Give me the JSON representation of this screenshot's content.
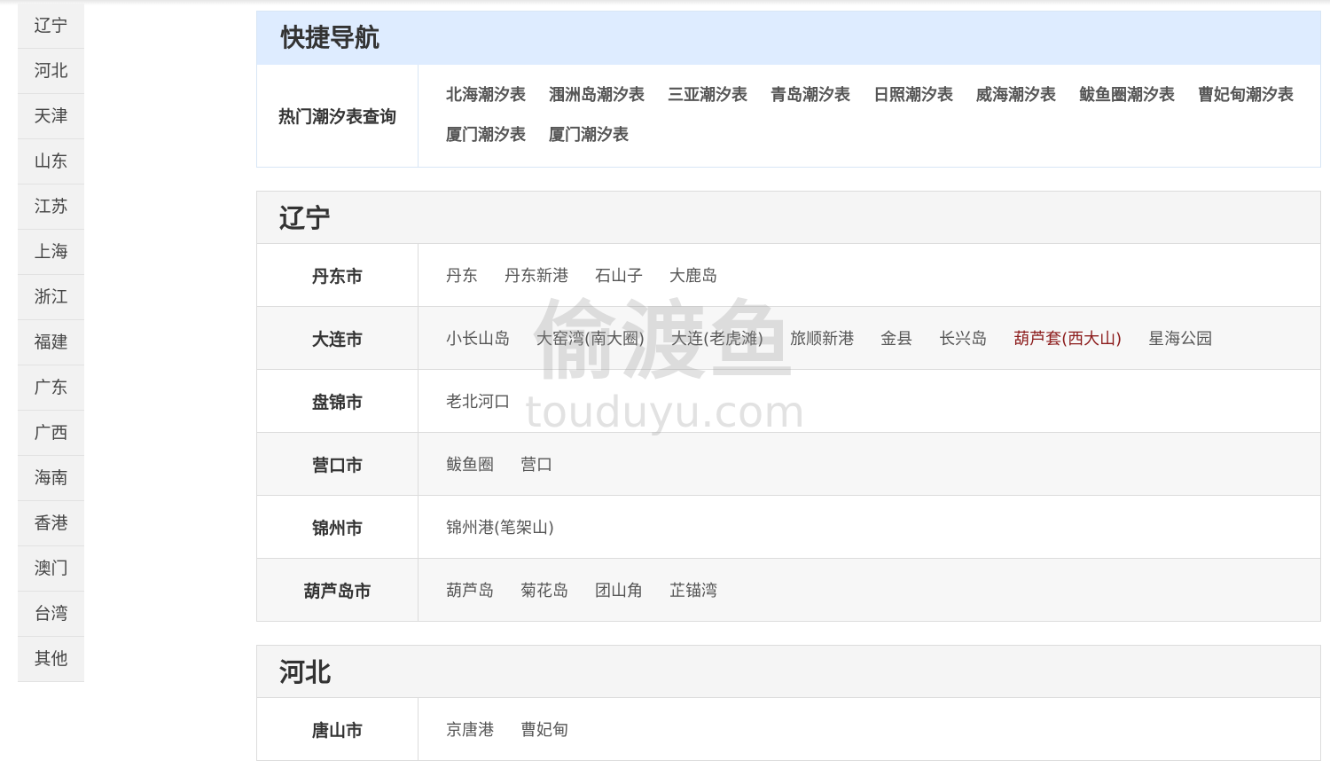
{
  "sidebar": {
    "items": [
      "辽宁",
      "河北",
      "天津",
      "山东",
      "江苏",
      "上海",
      "浙江",
      "福建",
      "广东",
      "广西",
      "海南",
      "香港",
      "澳门",
      "台湾",
      "其他"
    ]
  },
  "quicknav": {
    "title": "快捷导航",
    "label": "热门潮汐表查询",
    "links": [
      "北海潮汐表",
      "涠洲岛潮汐表",
      "三亚潮汐表",
      "青岛潮汐表",
      "日照潮汐表",
      "威海潮汐表",
      "鲅鱼圈潮汐表",
      "曹妃甸潮汐表",
      "厦门潮汐表",
      "厦门潮汐表"
    ]
  },
  "provinces": [
    {
      "name": "辽宁",
      "cities": [
        {
          "name": "丹东市",
          "ports": [
            "丹东",
            "丹东新港",
            "石山子",
            "大鹿岛"
          ]
        },
        {
          "name": "大连市",
          "ports": [
            "小长山岛",
            "大窑湾(南大圈)",
            "大连(老虎滩)",
            "旅顺新港",
            "金县",
            "长兴岛",
            "葫芦套(西大山)",
            "星海公园"
          ]
        },
        {
          "name": "盘锦市",
          "ports": [
            "老北河口"
          ]
        },
        {
          "name": "营口市",
          "ports": [
            "鲅鱼圈",
            "营口"
          ]
        },
        {
          "name": "锦州市",
          "ports": [
            "锦州港(笔架山)"
          ]
        },
        {
          "name": "葫芦岛市",
          "ports": [
            "葫芦岛",
            "菊花岛",
            "团山角",
            "芷锚湾"
          ]
        }
      ]
    },
    {
      "name": "河北",
      "cities": [
        {
          "name": "唐山市",
          "ports": [
            "京唐港",
            "曹妃甸"
          ]
        }
      ]
    }
  ],
  "highlight_port": "葫芦套(西大山)",
  "watermark": {
    "cn": "偷渡鱼",
    "en": "touduyu.com"
  },
  "colors": {
    "quicknav_bg": "#deecff",
    "highlight": "#8b1a1a"
  }
}
